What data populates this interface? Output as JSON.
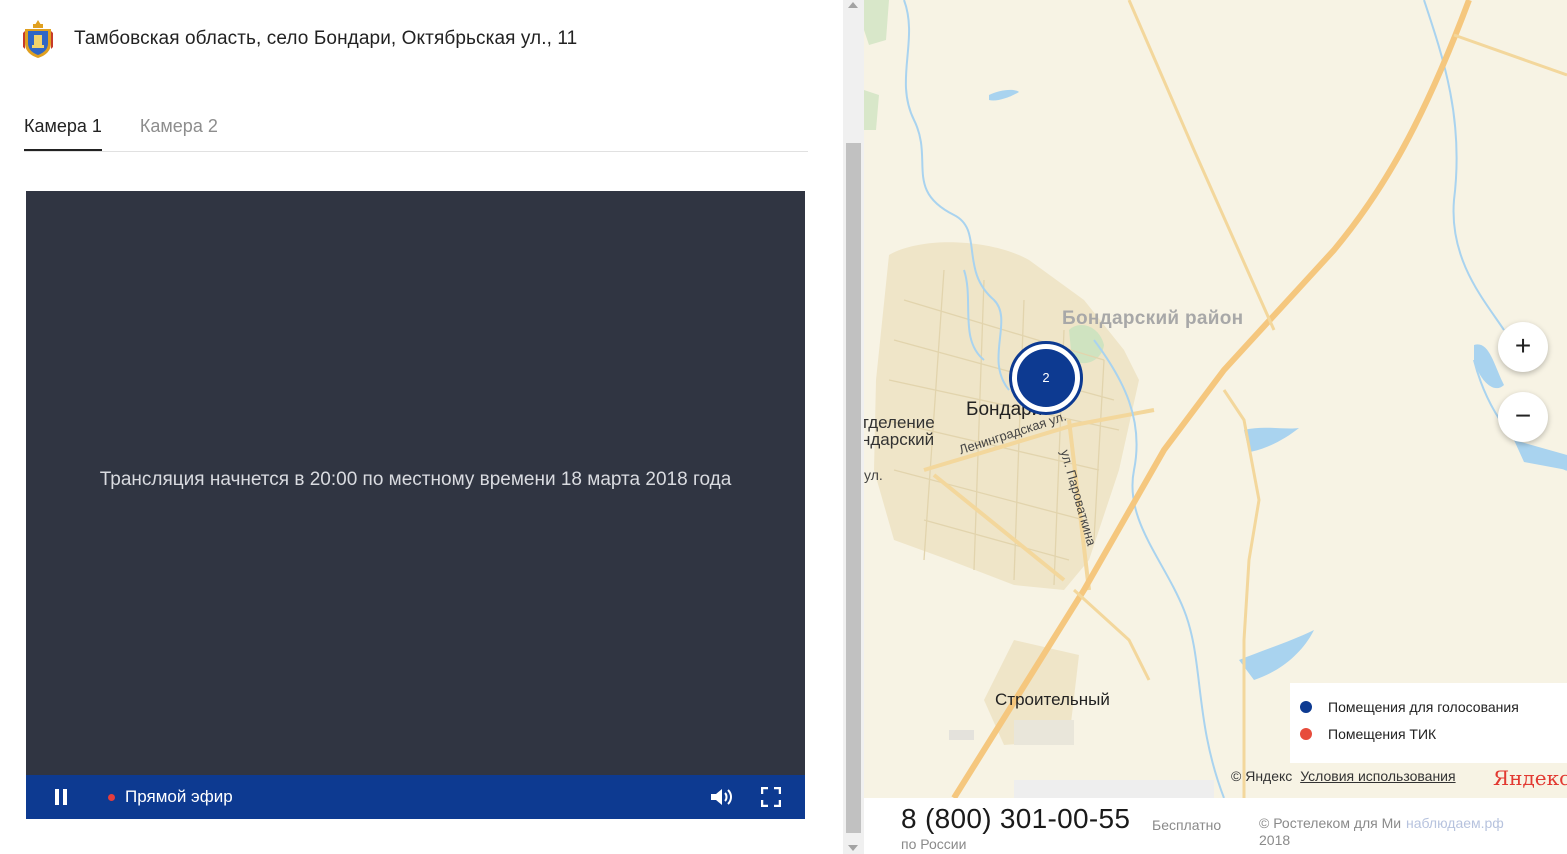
{
  "header": {
    "coat_of_arms_icon": "tambov-coat-of-arms-icon",
    "address": "Тамбовская область, село Бондари, Октябрьская ул., 11"
  },
  "tabs": [
    {
      "label": "Камера 1",
      "active": true
    },
    {
      "label": "Камера 2",
      "active": false
    }
  ],
  "player": {
    "message": "Трансляция начнется в 20:00 по местному времени 18 марта 2018 года",
    "live_label": "Прямой эфир",
    "icons": [
      "pause-icon",
      "live-dot-icon",
      "volume-icon",
      "fullscreen-icon"
    ]
  },
  "map": {
    "labels": {
      "district": "Бондарский район",
      "village": "Бондари",
      "branch_line1": "тделение",
      "branch_line2": "ндарский",
      "street_fragment": "ул.",
      "leningradskaya": "Ленинградская ул.",
      "parovatkina": "ул. Пароваткина",
      "stroitelny": "Строительный"
    },
    "cluster_count": "2",
    "zoom_in_label": "+",
    "zoom_out_label": "−",
    "legend": [
      {
        "label": "Помещения для голосования",
        "color": "#0d3a91"
      },
      {
        "label": "Помещения ТИК",
        "color": "#e74c3c"
      }
    ],
    "attribution": {
      "copyright": "© Яндекс",
      "terms_link": "Условия использования",
      "logo": "Яндекс"
    }
  },
  "footer": {
    "phone": "8 (800) 301-00-55",
    "phone_sub": "по России",
    "free": "Бесплатно",
    "copyright_line1": "© Ростелеком для Ми",
    "copyright_line2": "2018",
    "copyright_link": "наблюдаем.рф"
  },
  "colors": {
    "accent": "#0d3a91",
    "player_bg": "#303542",
    "map_bg": "#f7f3e4",
    "road": "#f5c77e",
    "water": "#a9d3ef"
  }
}
